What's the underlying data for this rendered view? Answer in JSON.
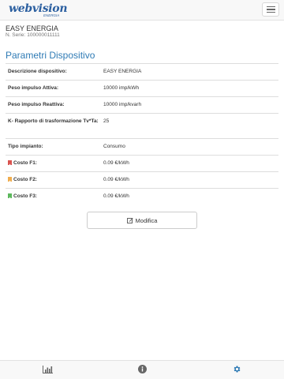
{
  "header": {
    "logo_text": "webvision",
    "logo_subtext": "ENERGIA"
  },
  "device": {
    "name": "EASY ENERGIA",
    "serial_label": "N. Serie:",
    "serial_value": "100000011111"
  },
  "section": {
    "title": "Parametri Dispositivo"
  },
  "params": [
    {
      "label": "Descrizione dispositivo:",
      "value": "EASY ENERGIA"
    },
    {
      "label": "Peso impulso Attiva:",
      "value": "10000 imp/kWh"
    },
    {
      "label": "Peso impulso Reattiva:",
      "value": "10000 imp/kvarh"
    },
    {
      "label": "K- Rapporto di trasformazione Tv*Ta:",
      "value": "25"
    },
    {
      "label": "Tipo impianto:",
      "value": "Consumo"
    },
    {
      "label": "Costo F1:",
      "value": "0.09 €/kWh"
    },
    {
      "label": "Costo F2:",
      "value": "0.09 €/kWh"
    },
    {
      "label": "Costo F3:",
      "value": "0.09 €/kWh"
    }
  ],
  "colors": {
    "accent": "#2f7bb5",
    "f1_flag": "#d9534f",
    "f2_flag": "#f0ad4e",
    "f3_flag": "#5cb85c"
  },
  "actions": {
    "edit_label": "Modifica"
  },
  "tabbar": {
    "items": [
      {
        "icon": "bar-chart-icon"
      },
      {
        "icon": "info-icon"
      },
      {
        "icon": "gear-icon",
        "active": true
      }
    ]
  }
}
